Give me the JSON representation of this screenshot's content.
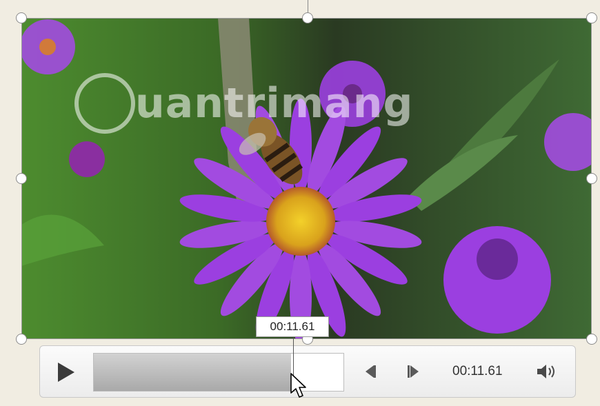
{
  "video": {
    "watermark_text": "uantrimang",
    "current_time_tooltip": "00:11.61"
  },
  "controls": {
    "play_icon": "play-icon",
    "progress": 0.79,
    "step_back_icon": "step-back-icon",
    "step_forward_icon": "step-forward-icon",
    "time": "00:11.61",
    "volume_icon": "speaker-icon"
  },
  "colors": {
    "petal": "#9b3fe0",
    "flower_center": "#e9c21e",
    "foliage": "#3c6e2a"
  }
}
